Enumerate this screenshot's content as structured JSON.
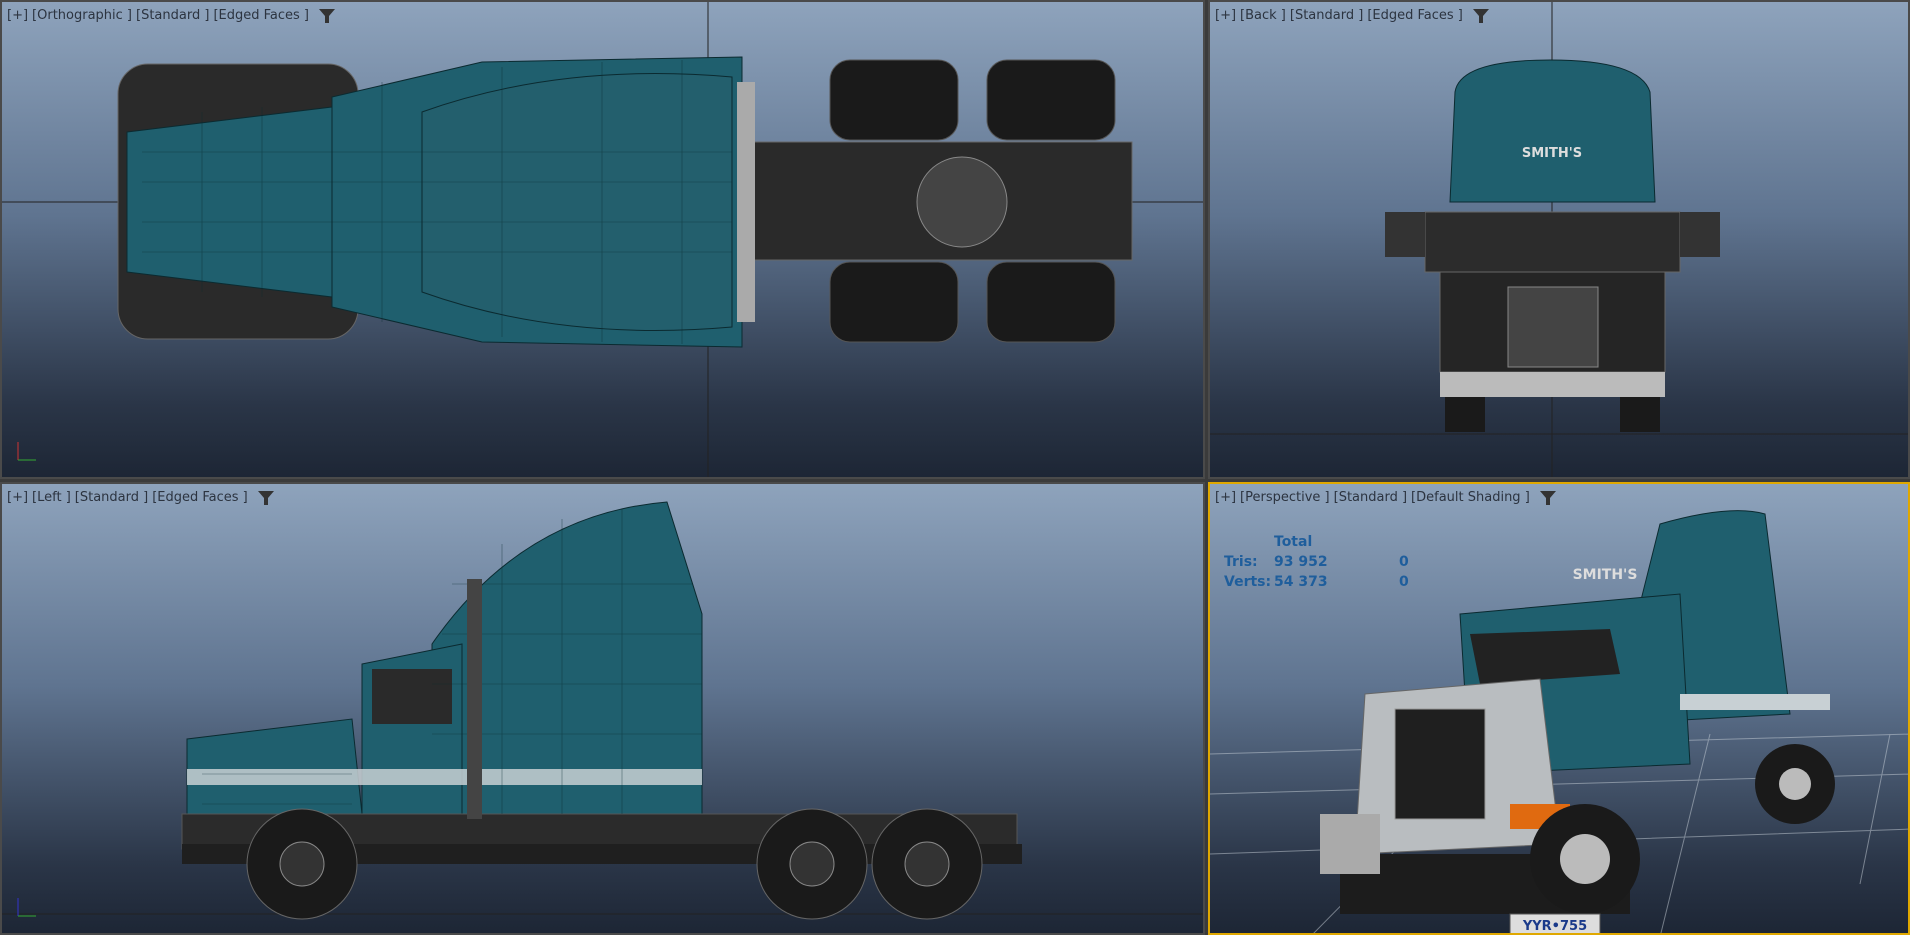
{
  "viewports": [
    {
      "plus": "[+]",
      "view": "[Orthographic ]",
      "mode": "[Standard ]",
      "shading": "[Edged Faces ]"
    },
    {
      "plus": "[+]",
      "view": "[Back ]",
      "mode": "[Standard ]",
      "shading": "[Edged Faces ]"
    },
    {
      "plus": "[+]",
      "view": "[Left ]",
      "mode": "[Standard ]",
      "shading": "[Edged Faces ]"
    },
    {
      "plus": "[+]",
      "view": "[Perspective ]",
      "mode": "[Standard ]",
      "shading": "[Default Shading ]"
    }
  ],
  "stats": {
    "header": "Total",
    "rows": [
      {
        "label": "Tris:",
        "total": "93 952",
        "selected": "0"
      },
      {
        "label": "Verts:",
        "total": "54 373",
        "selected": "0"
      }
    ]
  },
  "logo_text": "SMITH'S",
  "plate_text": "YYR•755",
  "colors": {
    "teal": "#1f5f6e",
    "chassis": "#2b2b2b",
    "chrome": "#bfc3c6",
    "accent": "#e0a800"
  }
}
